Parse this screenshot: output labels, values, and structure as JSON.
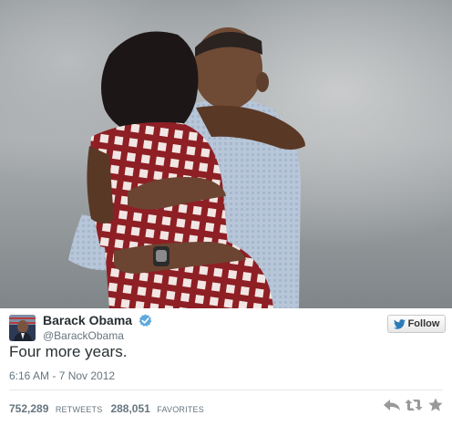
{
  "photo": {
    "icon": "photo-two-people-embracing"
  },
  "author": {
    "avatar_icon": "avatar-photo",
    "name": "Barack Obama",
    "handle": "@BarackObama",
    "verified_icon": "verified-badge-icon"
  },
  "follow": {
    "label": "Follow",
    "icon": "bird-icon"
  },
  "tweet": {
    "text": "Four more years.",
    "timestamp": "6:16 AM - 7 Nov 2012"
  },
  "stats": {
    "retweets_count": "752,289",
    "retweets_label": "RETWEETS",
    "favorites_count": "288,051",
    "favorites_label": "FAVORITES"
  },
  "actions": [
    "reply-icon",
    "retweet-icon",
    "favorite-icon"
  ],
  "colors": {
    "accent": "#2b7bb9",
    "muted": "#66757f",
    "text": "#292f33",
    "action_icon": "#999999"
  }
}
